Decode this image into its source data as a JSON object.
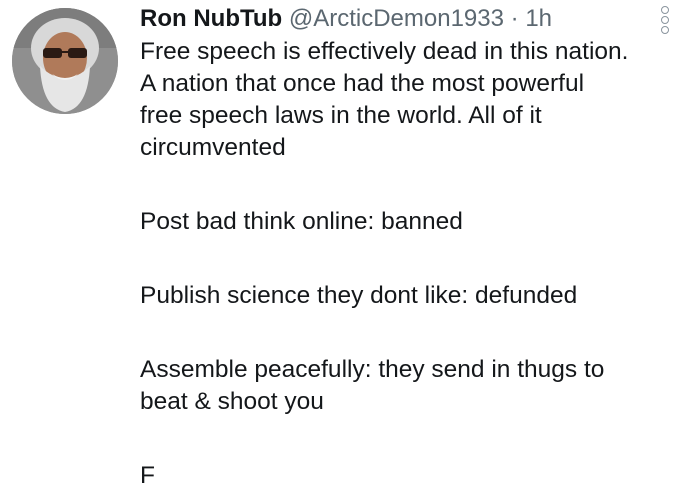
{
  "tweet": {
    "author_name": "Ron NubTub",
    "handle": "@ArcticDemon1933",
    "separator": "·",
    "time": "1h",
    "lines": {
      "p1_l1": "Free speech is effectively dead in this nation.",
      "p1_l2": "A nation that once had the most powerful",
      "p1_l3": "free speech laws in the world. All of it",
      "p1_l4": "circumvented",
      "p2": "Post bad think online: banned",
      "p3": "Publish science they dont like: defunded",
      "p4_l1": "Assemble peacefully: they send in thugs to",
      "p4_l2": "beat & shoot you",
      "p5": "F"
    }
  },
  "icons": {
    "avatar": "profile-photo",
    "more": "vertical-ellipsis-icon"
  },
  "colors": {
    "text": "#14171a",
    "secondary": "#5b6770",
    "background": "#ffffff"
  }
}
